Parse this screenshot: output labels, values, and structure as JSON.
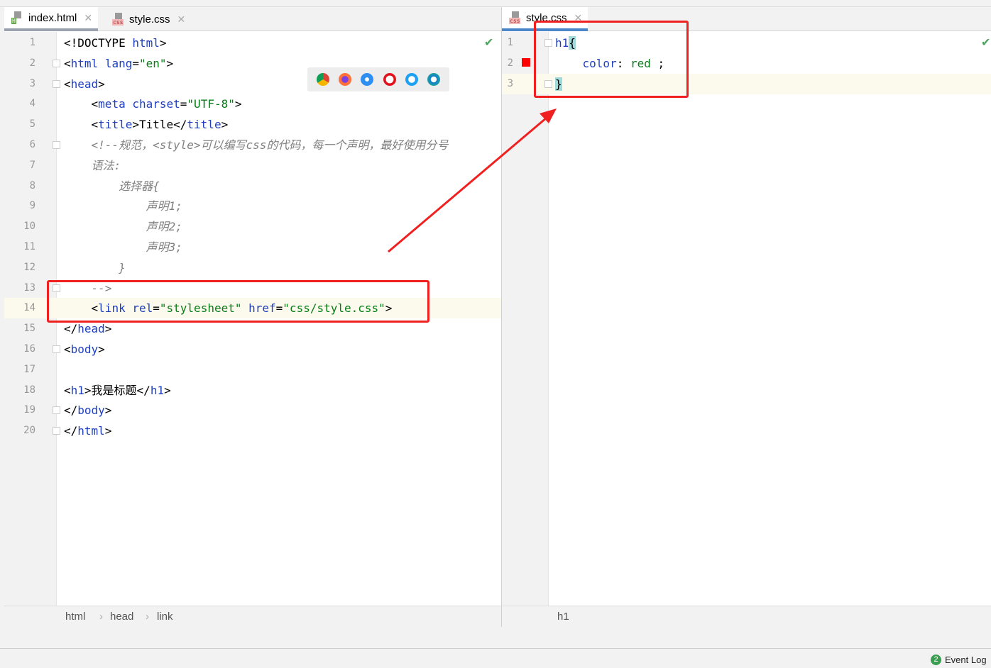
{
  "left_pane": {
    "tabs": [
      {
        "label": "index.html",
        "icon": "html-file-icon",
        "badge": "H",
        "active": true
      },
      {
        "label": "style.css",
        "icon": "css-file-icon",
        "badge": "css",
        "active": false
      }
    ],
    "current_line": 14,
    "lines": [
      [
        [
          "<!DOCTYPE ",
          "pl"
        ],
        [
          "html",
          "tag"
        ],
        [
          ">",
          "pl"
        ]
      ],
      [
        [
          "<",
          "pl"
        ],
        [
          "html ",
          "tag"
        ],
        [
          "lang",
          "attr"
        ],
        [
          "=",
          "pl"
        ],
        [
          "\"en\"",
          "str"
        ],
        [
          ">",
          "pl"
        ]
      ],
      [
        [
          "<",
          "pl"
        ],
        [
          "head",
          "tag"
        ],
        [
          ">",
          "pl"
        ]
      ],
      [
        [
          "    <",
          "pl"
        ],
        [
          "meta ",
          "tag"
        ],
        [
          "charset",
          "attr"
        ],
        [
          "=",
          "pl"
        ],
        [
          "\"UTF-8\"",
          "str"
        ],
        [
          ">",
          "pl"
        ]
      ],
      [
        [
          "    <",
          "pl"
        ],
        [
          "title",
          "tag"
        ],
        [
          ">Title</",
          "pl"
        ],
        [
          "title",
          "tag"
        ],
        [
          ">",
          "pl"
        ]
      ],
      [
        [
          "    <!--规范，<style>可以编写css的代码，每一个声明，最好使用分号",
          "com"
        ]
      ],
      [
        [
          "    语法:",
          "com"
        ]
      ],
      [
        [
          "        选择器{",
          "com"
        ]
      ],
      [
        [
          "            声明1;",
          "com"
        ]
      ],
      [
        [
          "            声明2;",
          "com"
        ]
      ],
      [
        [
          "            声明3;",
          "com"
        ]
      ],
      [
        [
          "        }",
          "com"
        ]
      ],
      [
        [
          "    -->",
          "com"
        ]
      ],
      [
        [
          "    <",
          "pl"
        ],
        [
          "link ",
          "tag"
        ],
        [
          "rel",
          "attr"
        ],
        [
          "=",
          "pl"
        ],
        [
          "\"stylesheet\" ",
          "str"
        ],
        [
          "href",
          "attr"
        ],
        [
          "=",
          "pl"
        ],
        [
          "\"css/style.css\"",
          "str"
        ],
        [
          ">",
          "pl"
        ]
      ],
      [
        [
          "</",
          "pl"
        ],
        [
          "head",
          "tag"
        ],
        [
          ">",
          "pl"
        ]
      ],
      [
        [
          "<",
          "pl"
        ],
        [
          "body",
          "tag"
        ],
        [
          ">",
          "pl"
        ]
      ],
      [],
      [
        [
          "<",
          "pl"
        ],
        [
          "h1",
          "tag"
        ],
        [
          ">我是标题</",
          "pl"
        ],
        [
          "h1",
          "tag"
        ],
        [
          ">",
          "pl"
        ]
      ],
      [
        [
          "</",
          "pl"
        ],
        [
          "body",
          "tag"
        ],
        [
          ">",
          "pl"
        ]
      ],
      [
        [
          "</",
          "pl"
        ],
        [
          "html",
          "tag"
        ],
        [
          ">",
          "pl"
        ]
      ]
    ],
    "breadcrumb": [
      "html",
      "head",
      "link"
    ],
    "browsers": [
      "chrome",
      "firefox",
      "safari",
      "opera",
      "internet-explorer",
      "edge"
    ]
  },
  "right_pane": {
    "tabs": [
      {
        "label": "style.css",
        "icon": "css-file-icon",
        "badge": "css",
        "active": true
      }
    ],
    "current_line": 3,
    "lines": [
      [
        [
          "h1",
          "tag"
        ],
        [
          "{",
          "brace"
        ]
      ],
      [
        [
          "    ",
          "pl"
        ],
        [
          "color",
          "attr"
        ],
        [
          ": ",
          "pl"
        ],
        [
          "red",
          "str"
        ],
        [
          " ;",
          "pl"
        ]
      ],
      [
        [
          "}",
          "brace"
        ]
      ]
    ],
    "color_swatch": "#ff0000",
    "breadcrumb": [
      "h1"
    ]
  },
  "status_bar": {
    "event_log_count": "2",
    "event_log_label": "Event Log"
  },
  "annotation_color": "#f02020"
}
